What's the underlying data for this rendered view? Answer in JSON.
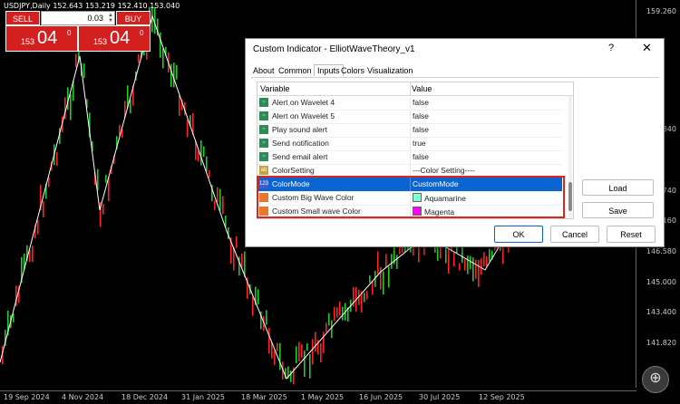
{
  "chart": {
    "symbol_title": "USDJPY,Daily  152.643 153.219 152.410 153.040",
    "price_ticks": [
      "159.260",
      "146.580",
      "145.000",
      "143.400",
      "141.820"
    ],
    "price_partial": [
      "840",
      "740",
      "160"
    ],
    "time_ticks": [
      "19 Sep 2024",
      "4 Nov 2024",
      "18 Dec 2024",
      "31 Jan 2025",
      "18 Mar 2025",
      "1 May 2025",
      "16 Jun 2025",
      "30 Jul 2025",
      "12 Sep 2025"
    ],
    "colors": {
      "up": "#22cc22",
      "down": "#ff2222",
      "wave": "#ffffff",
      "background": "#000000"
    }
  },
  "trade_panel": {
    "sell_label": "SELL",
    "buy_label": "BUY",
    "lot": "0.03",
    "sell_price_small": "153",
    "sell_price_big": "04",
    "sell_price_sup": "0",
    "buy_price_small": "153",
    "buy_price_big": "04",
    "buy_price_sup": "0",
    "color": "#d41f1f"
  },
  "dialog": {
    "title": "Custom Indicator - ElliotWaveTheory_v1",
    "help": "?",
    "close": "✕",
    "tabs": [
      "About",
      "Common",
      "Inputs",
      "Colors",
      "Visualization"
    ],
    "active_tab": "Inputs",
    "columns": {
      "variable": "Variable",
      "value": "Value"
    },
    "rows": [
      {
        "icon": "alert-icon",
        "variable": "Alert on Wavelet 4",
        "value": "false"
      },
      {
        "icon": "alert-icon",
        "variable": "Alert on Wavelet 5",
        "value": "false"
      },
      {
        "icon": "alert-icon",
        "variable": "Play sound alert",
        "value": "false"
      },
      {
        "icon": "alert-icon",
        "variable": "Send notification",
        "value": "true"
      },
      {
        "icon": "alert-icon",
        "variable": "Send email alert",
        "value": "false"
      },
      {
        "icon": "text-icon",
        "variable": "ColorSetting",
        "value": "---Color Setting----"
      },
      {
        "icon": "number-icon",
        "variable": "ColorMode",
        "value": "CustomMode"
      },
      {
        "icon": "color-icon",
        "variable": "Custom Big Wave Color",
        "value": "Aquamarine",
        "swatch": "#7fffd4"
      },
      {
        "icon": "color-icon",
        "variable": "Custom Small wave Color",
        "value": "Magenta",
        "swatch": "#ff00ff"
      }
    ],
    "icon_text": {
      "num": "123",
      "ab": "ab"
    },
    "buttons": {
      "load": "Load",
      "save": "Save",
      "ok": "OK",
      "cancel": "Cancel",
      "reset": "Reset"
    },
    "highlight_color": "#e0241b",
    "selected_color": "#0a64d2"
  },
  "zoom_icon": "⊕"
}
